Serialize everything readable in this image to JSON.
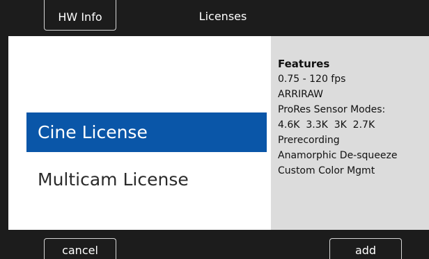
{
  "header": {
    "title": "Licenses",
    "hw_info_label": "HW Info"
  },
  "licenses": {
    "items": [
      {
        "label": "Cine License",
        "selected": true
      },
      {
        "label": "Multicam License",
        "selected": false
      }
    ],
    "selected_color": "#0a56a8"
  },
  "features": {
    "title": "Features",
    "lines": [
      "0.75 - 120 fps",
      "ARRIRAW",
      "ProRes Sensor Modes:",
      "4.6K  3.3K  3K  2.7K",
      "Prerecording",
      "Anamorphic De-squeeze",
      "Custom Color Mgmt"
    ]
  },
  "footer": {
    "cancel_label": "cancel",
    "add_label": "add"
  }
}
